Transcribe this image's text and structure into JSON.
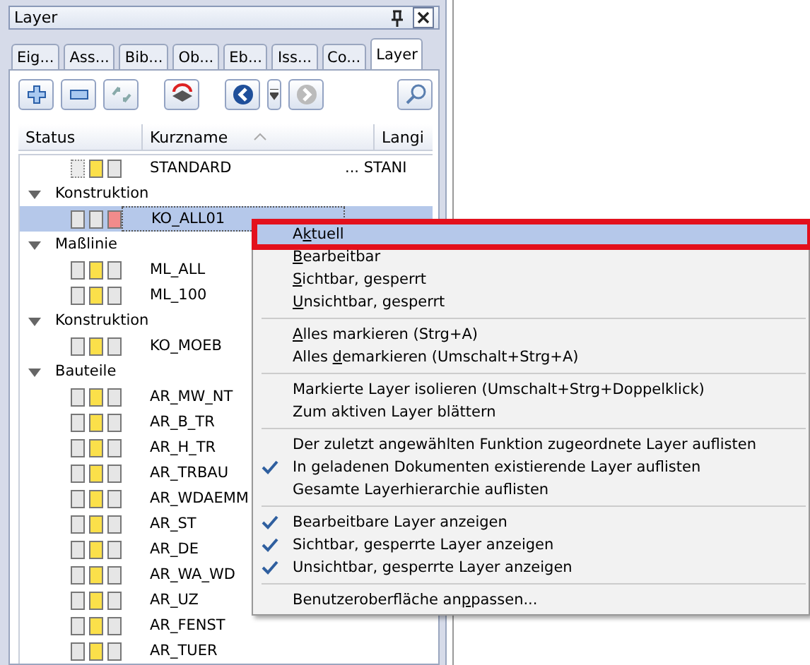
{
  "panel": {
    "title": "Layer"
  },
  "tabs": [
    {
      "label": "Eig...",
      "selected": false
    },
    {
      "label": "Ass...",
      "selected": false
    },
    {
      "label": "Bib...",
      "selected": false
    },
    {
      "label": "Ob...",
      "selected": false
    },
    {
      "label": "Eb...",
      "selected": false
    },
    {
      "label": "Iss...",
      "selected": false
    },
    {
      "label": "Co...",
      "selected": false
    },
    {
      "label": "Layer",
      "selected": true
    }
  ],
  "columns": [
    "Status",
    "Kurzname",
    "Langi"
  ],
  "tree": [
    {
      "kind": "layer",
      "name": "STANDARD",
      "long": "... STANI",
      "selected": false,
      "status": [
        {
          "color": "#ececec",
          "dotted": true
        },
        {
          "color": "#fbe04a",
          "dotted": false
        },
        {
          "color": "#e6e6e6",
          "dotted": false
        }
      ]
    },
    {
      "kind": "group",
      "name": "Konstruktion",
      "expanded": true,
      "children": [
        {
          "kind": "layer",
          "name": "KO_ALL01",
          "selected": true,
          "status": [
            {
              "color": "#e6e6e6",
              "dotted": false
            },
            {
              "color": "#e6e6e6",
              "dotted": false
            },
            {
              "color": "#f28b8b",
              "dotted": false
            }
          ]
        }
      ]
    },
    {
      "kind": "group",
      "name": "Maßlinie",
      "expanded": true,
      "children": [
        {
          "kind": "layer",
          "name": "ML_ALL",
          "selected": false,
          "status": [
            {
              "color": "#e6e6e6",
              "dotted": false
            },
            {
              "color": "#fbe04a",
              "dotted": false
            },
            {
              "color": "#e6e6e6",
              "dotted": false
            }
          ]
        },
        {
          "kind": "layer",
          "name": "ML_100",
          "selected": false,
          "status": [
            {
              "color": "#e6e6e6",
              "dotted": false
            },
            {
              "color": "#fbe04a",
              "dotted": false
            },
            {
              "color": "#e6e6e6",
              "dotted": false
            }
          ]
        }
      ]
    },
    {
      "kind": "group",
      "name": "Konstruktion",
      "expanded": true,
      "children": [
        {
          "kind": "layer",
          "name": "KO_MOEB",
          "selected": false,
          "status": [
            {
              "color": "#e6e6e6",
              "dotted": false
            },
            {
              "color": "#fbe04a",
              "dotted": false
            },
            {
              "color": "#e6e6e6",
              "dotted": false
            }
          ]
        }
      ]
    },
    {
      "kind": "group",
      "name": "Bauteile",
      "expanded": true,
      "children": [
        {
          "kind": "layer",
          "name": "AR_MW_NT",
          "selected": false,
          "status": [
            {
              "color": "#e6e6e6",
              "dotted": false
            },
            {
              "color": "#fbe04a",
              "dotted": false
            },
            {
              "color": "#e6e6e6",
              "dotted": false
            }
          ]
        },
        {
          "kind": "layer",
          "name": "AR_B_TR",
          "selected": false,
          "status": [
            {
              "color": "#e6e6e6",
              "dotted": false
            },
            {
              "color": "#fbe04a",
              "dotted": false
            },
            {
              "color": "#e6e6e6",
              "dotted": false
            }
          ]
        },
        {
          "kind": "layer",
          "name": "AR_H_TR",
          "selected": false,
          "status": [
            {
              "color": "#e6e6e6",
              "dotted": false
            },
            {
              "color": "#fbe04a",
              "dotted": false
            },
            {
              "color": "#e6e6e6",
              "dotted": false
            }
          ]
        },
        {
          "kind": "layer",
          "name": "AR_TRBAU",
          "selected": false,
          "status": [
            {
              "color": "#e6e6e6",
              "dotted": false
            },
            {
              "color": "#fbe04a",
              "dotted": false
            },
            {
              "color": "#e6e6e6",
              "dotted": false
            }
          ]
        },
        {
          "kind": "layer",
          "name": "AR_WDAEMM",
          "selected": false,
          "status": [
            {
              "color": "#e6e6e6",
              "dotted": false
            },
            {
              "color": "#fbe04a",
              "dotted": false
            },
            {
              "color": "#e6e6e6",
              "dotted": false
            }
          ]
        },
        {
          "kind": "layer",
          "name": "AR_ST",
          "selected": false,
          "status": [
            {
              "color": "#e6e6e6",
              "dotted": false
            },
            {
              "color": "#fbe04a",
              "dotted": false
            },
            {
              "color": "#e6e6e6",
              "dotted": false
            }
          ]
        },
        {
          "kind": "layer",
          "name": "AR_DE",
          "selected": false,
          "status": [
            {
              "color": "#e6e6e6",
              "dotted": false
            },
            {
              "color": "#fbe04a",
              "dotted": false
            },
            {
              "color": "#e6e6e6",
              "dotted": false
            }
          ]
        },
        {
          "kind": "layer",
          "name": "AR_WA_WD",
          "selected": false,
          "status": [
            {
              "color": "#e6e6e6",
              "dotted": false
            },
            {
              "color": "#fbe04a",
              "dotted": false
            },
            {
              "color": "#e6e6e6",
              "dotted": false
            }
          ]
        },
        {
          "kind": "layer",
          "name": "AR_UZ",
          "selected": false,
          "status": [
            {
              "color": "#e6e6e6",
              "dotted": false
            },
            {
              "color": "#fbe04a",
              "dotted": false
            },
            {
              "color": "#e6e6e6",
              "dotted": false
            }
          ]
        },
        {
          "kind": "layer",
          "name": "AR_FENST",
          "selected": false,
          "status": [
            {
              "color": "#e6e6e6",
              "dotted": false
            },
            {
              "color": "#fbe04a",
              "dotted": false
            },
            {
              "color": "#e6e6e6",
              "dotted": false
            }
          ]
        },
        {
          "kind": "layer",
          "name": "AR_TUER",
          "selected": false,
          "status": [
            {
              "color": "#e6e6e6",
              "dotted": false
            },
            {
              "color": "#fbe04a",
              "dotted": false
            },
            {
              "color": "#e6e6e6",
              "dotted": false
            }
          ]
        }
      ]
    }
  ],
  "context_menu": [
    {
      "kind": "item",
      "pre": "A",
      "key": "k",
      "post": "tuell",
      "checked": false,
      "selected": true
    },
    {
      "kind": "item",
      "key": "B",
      "post": "earbeitbar",
      "checked": false,
      "selected": false
    },
    {
      "kind": "item",
      "key": "S",
      "post": "ichtbar, gesperrt",
      "checked": false,
      "selected": false
    },
    {
      "kind": "item",
      "key": "U",
      "post": "nsichtbar, gesperrt",
      "checked": false,
      "selected": false
    },
    {
      "kind": "separator"
    },
    {
      "kind": "item",
      "key": "A",
      "post": "lles markieren (Strg+A)",
      "checked": false,
      "selected": false
    },
    {
      "kind": "item",
      "pre": "Alles ",
      "key": "d",
      "post": "emarkieren (Umschalt+Strg+A)",
      "checked": false,
      "selected": false
    },
    {
      "kind": "separator"
    },
    {
      "kind": "item",
      "pre": "Markierte Layer isolieren (Umschalt+Strg+Doppelklick)",
      "checked": false,
      "selected": false
    },
    {
      "kind": "item",
      "pre": "Zum aktiven Layer blättern",
      "checked": false,
      "selected": false
    },
    {
      "kind": "separator"
    },
    {
      "kind": "item",
      "pre": "Der zuletzt angewählten Funktion zugeordnete Layer auflisten",
      "checked": false,
      "selected": false
    },
    {
      "kind": "item",
      "pre": "In geladenen Dokumenten existierende Layer auflisten",
      "checked": true,
      "selected": false
    },
    {
      "kind": "item",
      "pre": "Gesamte Layerhierarchie auflisten",
      "checked": false,
      "selected": false
    },
    {
      "kind": "separator"
    },
    {
      "kind": "item",
      "pre": "Bearbeitbare Layer anzeigen",
      "checked": true,
      "selected": false
    },
    {
      "kind": "item",
      "pre": "Sichtbar, gesperrte Layer anzeigen",
      "checked": true,
      "selected": false
    },
    {
      "kind": "item",
      "pre": "Unsichtbar, gesperrte Layer anzeigen",
      "checked": true,
      "selected": false
    },
    {
      "kind": "separator"
    },
    {
      "kind": "item",
      "pre": "Benutzeroberfläche an",
      "key": "p",
      "post": "passen...",
      "checked": false,
      "selected": false
    }
  ]
}
